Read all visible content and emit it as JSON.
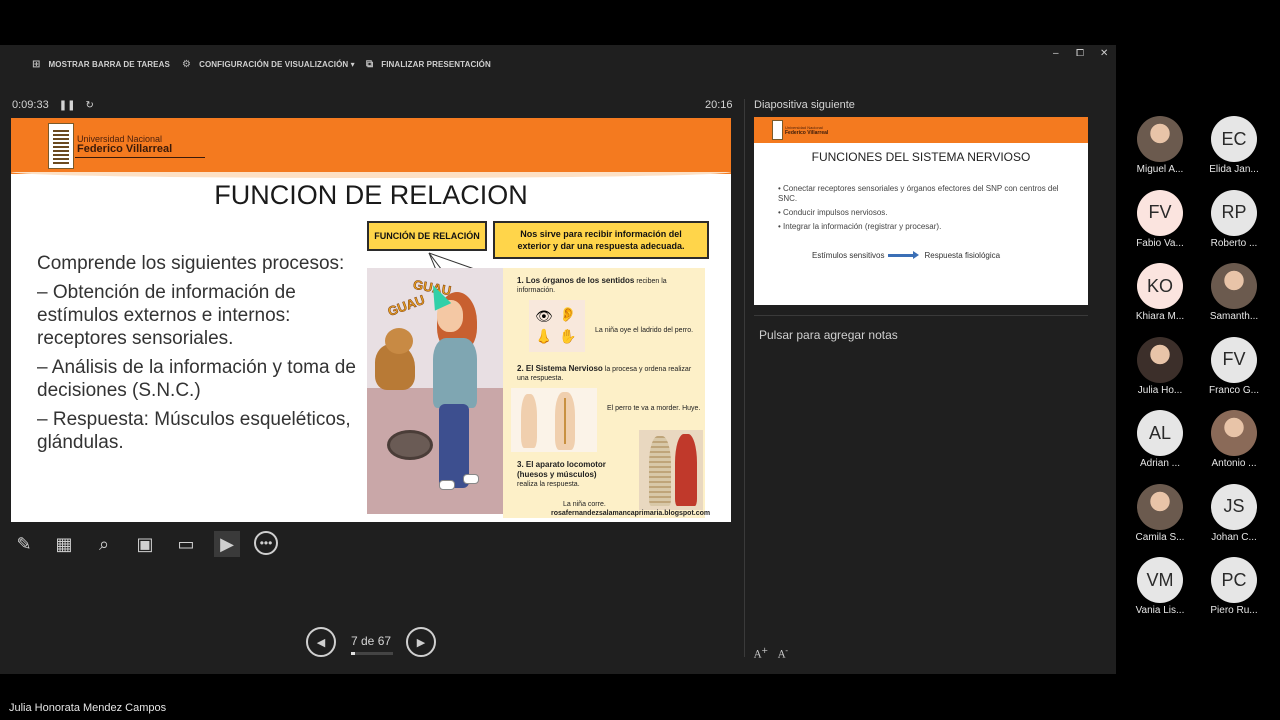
{
  "toolbar": {
    "taskbar_label": "MOSTRAR BARRA DE TAREAS",
    "display_settings_label": "CONFIGURACIÓN DE VISUALIZACIÓN ▾",
    "end_show_label": "FINALIZAR PRESENTACIÓN"
  },
  "timer": {
    "elapsed": "0:09:33",
    "clock": "20:16"
  },
  "current_slide": {
    "university_line1": "Universidad Nacional",
    "university_line2": "Federico Villarreal",
    "title": "FUNCION DE RELACION",
    "intro": "Comprende los siguientes procesos:",
    "points": [
      "– Obtención de información de estímulos externos e internos: receptores sensoriales.",
      "– Análisis de la información y toma de decisiones (S.N.C.)",
      "– Respuesta: Músculos esqueléticos, glándulas."
    ],
    "box_function": "FUNCIÓN DE RELACIÓN",
    "box_description": "Nos sirve para recibir información del exterior y dar una respuesta adecuada.",
    "guau_1": "GUAU",
    "guau_2": "GUAU",
    "panel": {
      "item1_title": "1. Los órganos de los sentidos",
      "item1_rest": "reciben la información.",
      "item1_caption": "La niña oye el ladrido del perro.",
      "item2_title": "2. El Sistema Nervioso",
      "item2_rest": "la procesa y ordena realizar una respuesta.",
      "item2_caption": "El perro te va a morder. Huye.",
      "item3_title": "3. El aparato locomotor (huesos y músculos)",
      "item3_rest": "realiza la respuesta.",
      "item3_caption": "La niña corre.",
      "source": "rosafernandezsalamancaprimaria.blogspot.com"
    }
  },
  "navigation": {
    "slide_count": "7 de 67",
    "current": 7,
    "total": 67
  },
  "next_slide": {
    "label": "Diapositiva siguiente",
    "university_line1": "Universidad Nacional",
    "university_line2": "Federico Villarreal",
    "title": "FUNCIONES DEL SISTEMA NERVIOSO",
    "bullets": [
      "Conectar receptores sensoriales y órganos efectores del SNP con centros del SNC.",
      "Conducir impulsos nerviosos.",
      "Integrar la información (registrar y procesar)."
    ],
    "flow_from": "Estímulos sensitivos",
    "flow_to": "Respuesta fisiológica"
  },
  "notes": {
    "placeholder": "Pulsar para agregar notas"
  },
  "participants": [
    {
      "initials": "",
      "name": "Miguel A...",
      "photo": true
    },
    {
      "initials": "EC",
      "name": "Elida Jan...",
      "photo": false,
      "color": "#e6e6e6"
    },
    {
      "initials": "FV",
      "name": "Fabio Va...",
      "photo": false,
      "color": "#fbe4df"
    },
    {
      "initials": "RP",
      "name": "Roberto ...",
      "photo": false,
      "color": "#e6e6e6"
    },
    {
      "initials": "KO",
      "name": "Khiara M...",
      "photo": false,
      "color": "#fbe4df"
    },
    {
      "initials": "",
      "name": "Samanth...",
      "photo": true
    },
    {
      "initials": "",
      "name": "Julia Ho...",
      "photo": true
    },
    {
      "initials": "FV",
      "name": "Franco G...",
      "photo": false,
      "color": "#e6e6e6"
    },
    {
      "initials": "AL",
      "name": "Adrian ...",
      "photo": false,
      "color": "#e6e6e6"
    },
    {
      "initials": "",
      "name": "Antonio ...",
      "photo": true
    },
    {
      "initials": "",
      "name": "Camila S...",
      "photo": true
    },
    {
      "initials": "JS",
      "name": "Johan C...",
      "photo": false,
      "color": "#e6e6e6"
    },
    {
      "initials": "VM",
      "name": "Vania Lis...",
      "photo": false,
      "color": "#e6e6e6"
    },
    {
      "initials": "PC",
      "name": "Piero Ru...",
      "photo": false,
      "color": "#e6e6e6"
    }
  ],
  "presenter_name": "Julia Honorata Mendez Campos",
  "colors": {
    "accent_orange": "#f47a1f",
    "highlight_yellow": "#ffd54a",
    "background": "#1f1f1f"
  }
}
